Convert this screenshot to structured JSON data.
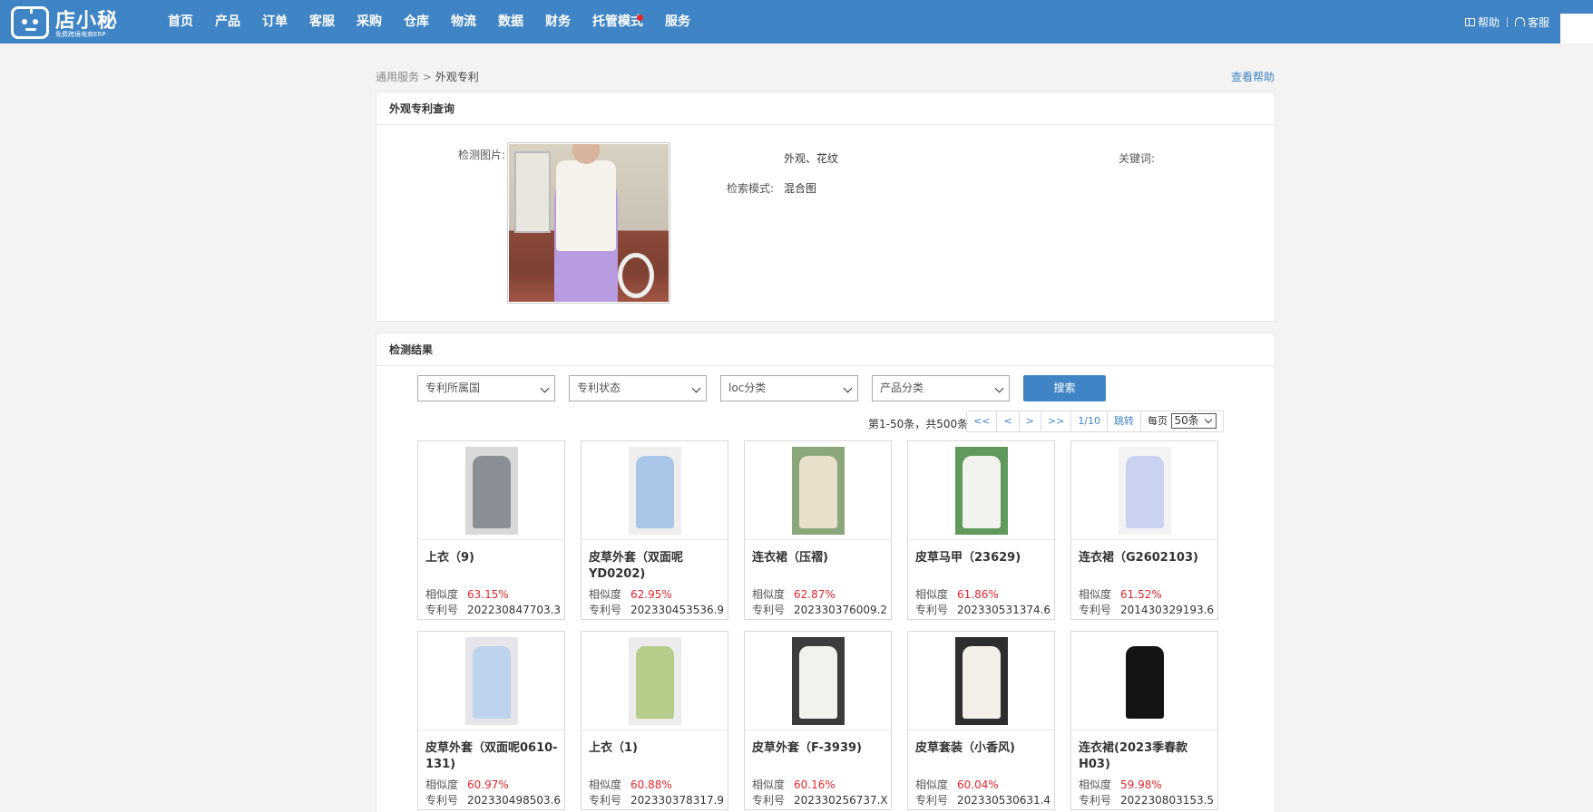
{
  "brand": {
    "name": "店小秘",
    "tagline": "免费跨境电商ERP"
  },
  "nav": {
    "items": [
      "首页",
      "产品",
      "订单",
      "客服",
      "采购",
      "仓库",
      "物流",
      "数据",
      "财务",
      "托管模式",
      "服务"
    ],
    "help": "帮助",
    "service": "客服"
  },
  "breadcrumb": {
    "parent": "通用服务",
    "separator": ">",
    "current": "外观专利"
  },
  "help_link": "查看帮助",
  "query": {
    "title": "外观专利查询",
    "image_label": "检测图片:",
    "keyword_label": "关键词:",
    "keyword_value": "外观、花纹",
    "mode_label": "检索模式:",
    "mode_value": "混合图"
  },
  "results": {
    "title": "检测结果",
    "filters": [
      "专利所属国",
      "专利状态",
      "loc分类",
      "产品分类"
    ],
    "search_button": "搜索",
    "pager": {
      "info": "第1-50条，共500条",
      "first": "<<",
      "prev": "<",
      "next": ">",
      "last": ">>",
      "page": "1/10",
      "jump": "跳转",
      "per_page_label": "每页",
      "per_page_value": "50条"
    },
    "sim_label": "相似度",
    "patent_label": "专利号",
    "items": [
      {
        "title": "上衣（9)",
        "similarity": "63.15%",
        "patent": "202230847703.3",
        "color": "#8a8f96",
        "bg": "#d9d9d9"
      },
      {
        "title": "皮草外套（双面呢YD0202)",
        "similarity": "62.95%",
        "patent": "202330453536.9",
        "color": "#a9c6e8",
        "bg": "#eeeeee"
      },
      {
        "title": "连衣裙（压褶)",
        "similarity": "62.87%",
        "patent": "202330376009.2",
        "color": "#e9e0cc",
        "bg": "#8aa67a"
      },
      {
        "title": "皮草马甲（23629)",
        "similarity": "61.86%",
        "patent": "202330531374.6",
        "color": "#f2f2ee",
        "bg": "#5f9a5c"
      },
      {
        "title": "连衣裙（G2602103)",
        "similarity": "61.52%",
        "patent": "201430329193.6",
        "color": "#c9d2ef",
        "bg": "#f3f3f5"
      },
      {
        "title": "皮草外套（双面呢0610-131)",
        "similarity": "60.97%",
        "patent": "202330498503.6",
        "color": "#bed3ec",
        "bg": "#e6e6ea"
      },
      {
        "title": "上衣（1)",
        "similarity": "60.88%",
        "patent": "202330378317.9",
        "color": "#b6cc8a",
        "bg": "#ececec"
      },
      {
        "title": "皮草外套（F-3939)",
        "similarity": "60.16%",
        "patent": "202330256737.X",
        "color": "#f3f1ec",
        "bg": "#3c3c3c"
      },
      {
        "title": "皮草套装（小香风)",
        "similarity": "60.04%",
        "patent": "202330530631.4",
        "color": "#f1efe8",
        "bg": "#2e2e2e"
      },
      {
        "title": "连衣裙(2023季春款H03)",
        "similarity": "59.98%",
        "patent": "202230803153.5",
        "color": "#141414",
        "bg": "#ffffff"
      }
    ]
  }
}
